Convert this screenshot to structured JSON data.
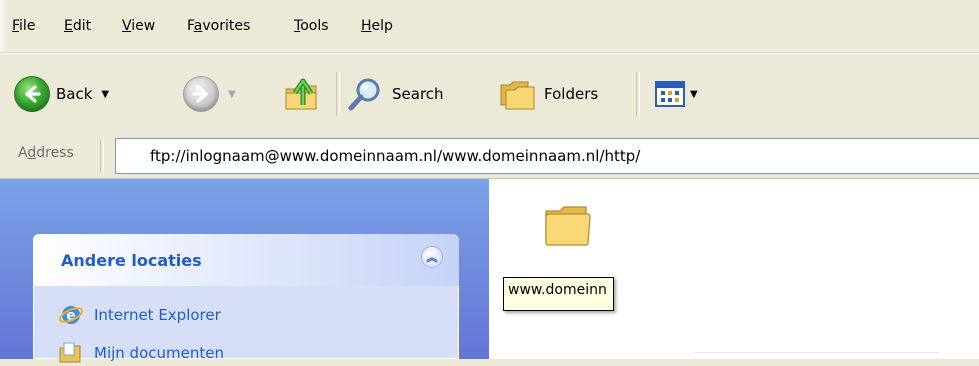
{
  "menubar": {
    "items": [
      {
        "label": "File",
        "accel": "F",
        "rest": "ile"
      },
      {
        "label": "Edit",
        "accel": "E",
        "rest": "dit"
      },
      {
        "label": "View",
        "accel": "V",
        "rest": "iew"
      },
      {
        "label": "Favorites",
        "pre": "F",
        "accel": "a",
        "rest": "vorites"
      },
      {
        "label": "Tools",
        "accel": "T",
        "rest": "ools"
      },
      {
        "label": "Help",
        "accel": "H",
        "rest": "elp"
      }
    ]
  },
  "toolbar": {
    "back_label": "Back",
    "search_label": "Search",
    "folders_label": "Folders"
  },
  "address": {
    "label_pre": "A",
    "label_accel": "d",
    "label_rest": "dress",
    "value": "ftp://inlognaam@www.domeinnaam.nl/www.domeinnaam.nl/http/"
  },
  "taskpane": {
    "panel_title": "Andere locaties",
    "items": [
      {
        "label": "Internet Explorer",
        "icon": "ie-icon"
      },
      {
        "label": "Mijn documenten",
        "icon": "my-documents-icon"
      }
    ]
  },
  "content": {
    "folder_label": "www.domeinn"
  },
  "colors": {
    "task_blue": "#215dc6",
    "pane_top": "#7ba2e7",
    "pane_bottom": "#6375d6",
    "chrome": "#ece9d8",
    "tooltip_bg": "#ffffe1"
  }
}
